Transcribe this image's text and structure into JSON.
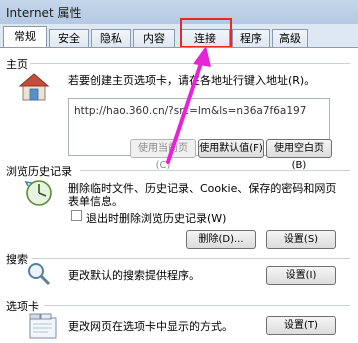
{
  "window": {
    "title": "Internet 属性"
  },
  "tabs": [
    {
      "label": "常规"
    },
    {
      "label": "安全"
    },
    {
      "label": "隐私"
    },
    {
      "label": "内容"
    },
    {
      "label": "连接"
    },
    {
      "label": "程序"
    },
    {
      "label": "高级"
    }
  ],
  "home": {
    "title": "主页",
    "desc": "若要创建主页选项卡，请在各地址行键入地址(R)。",
    "url_value": "http://hao.360.cn/?src=lm&ls=n36a7f6a197",
    "use_current_label": "使用当前页(C)",
    "use_default_label": "使用默认值(F)",
    "use_blank_label": "使用空白页(B)"
  },
  "history": {
    "title": "浏览历史记录",
    "desc_line1": "删除临时文件、历史记录、Cookie、保存的密码和网页",
    "desc_line2": "表单信息。",
    "checkbox_label": "退出时删除浏览历史记录(W)",
    "delete_label": "删除(D)...",
    "settings_label": "设置(S)"
  },
  "search": {
    "title": "搜索",
    "desc": "更改默认的搜索提供程序。",
    "settings_label": "设置(I)"
  },
  "tabs_section": {
    "title": "选项卡",
    "desc": "更改网页在选项卡中显示的方式。",
    "settings_label": "设置(T)"
  }
}
